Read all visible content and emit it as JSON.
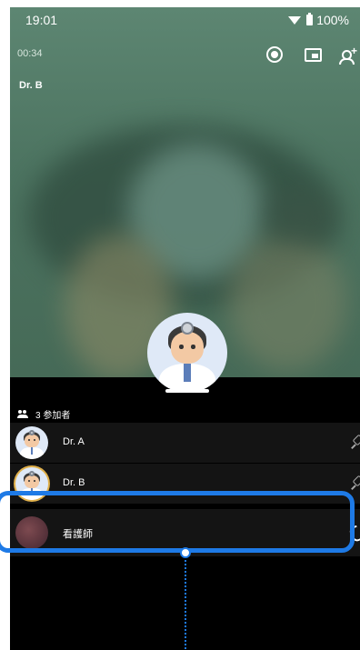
{
  "status_bar": {
    "time": "19:01",
    "battery": "100%"
  },
  "call": {
    "duration": "00:34",
    "speaker_name": "Dr. B"
  },
  "participants": {
    "count_label": "3 参加者",
    "items": [
      {
        "name": "Dr. A",
        "action": "pin-icon"
      },
      {
        "name": "Dr. B",
        "action": "pin-icon"
      },
      {
        "name": "看護師",
        "action": "phone-icon"
      }
    ]
  },
  "colors": {
    "highlight": "#1e7ae6",
    "video_bg": "#4c7360"
  }
}
